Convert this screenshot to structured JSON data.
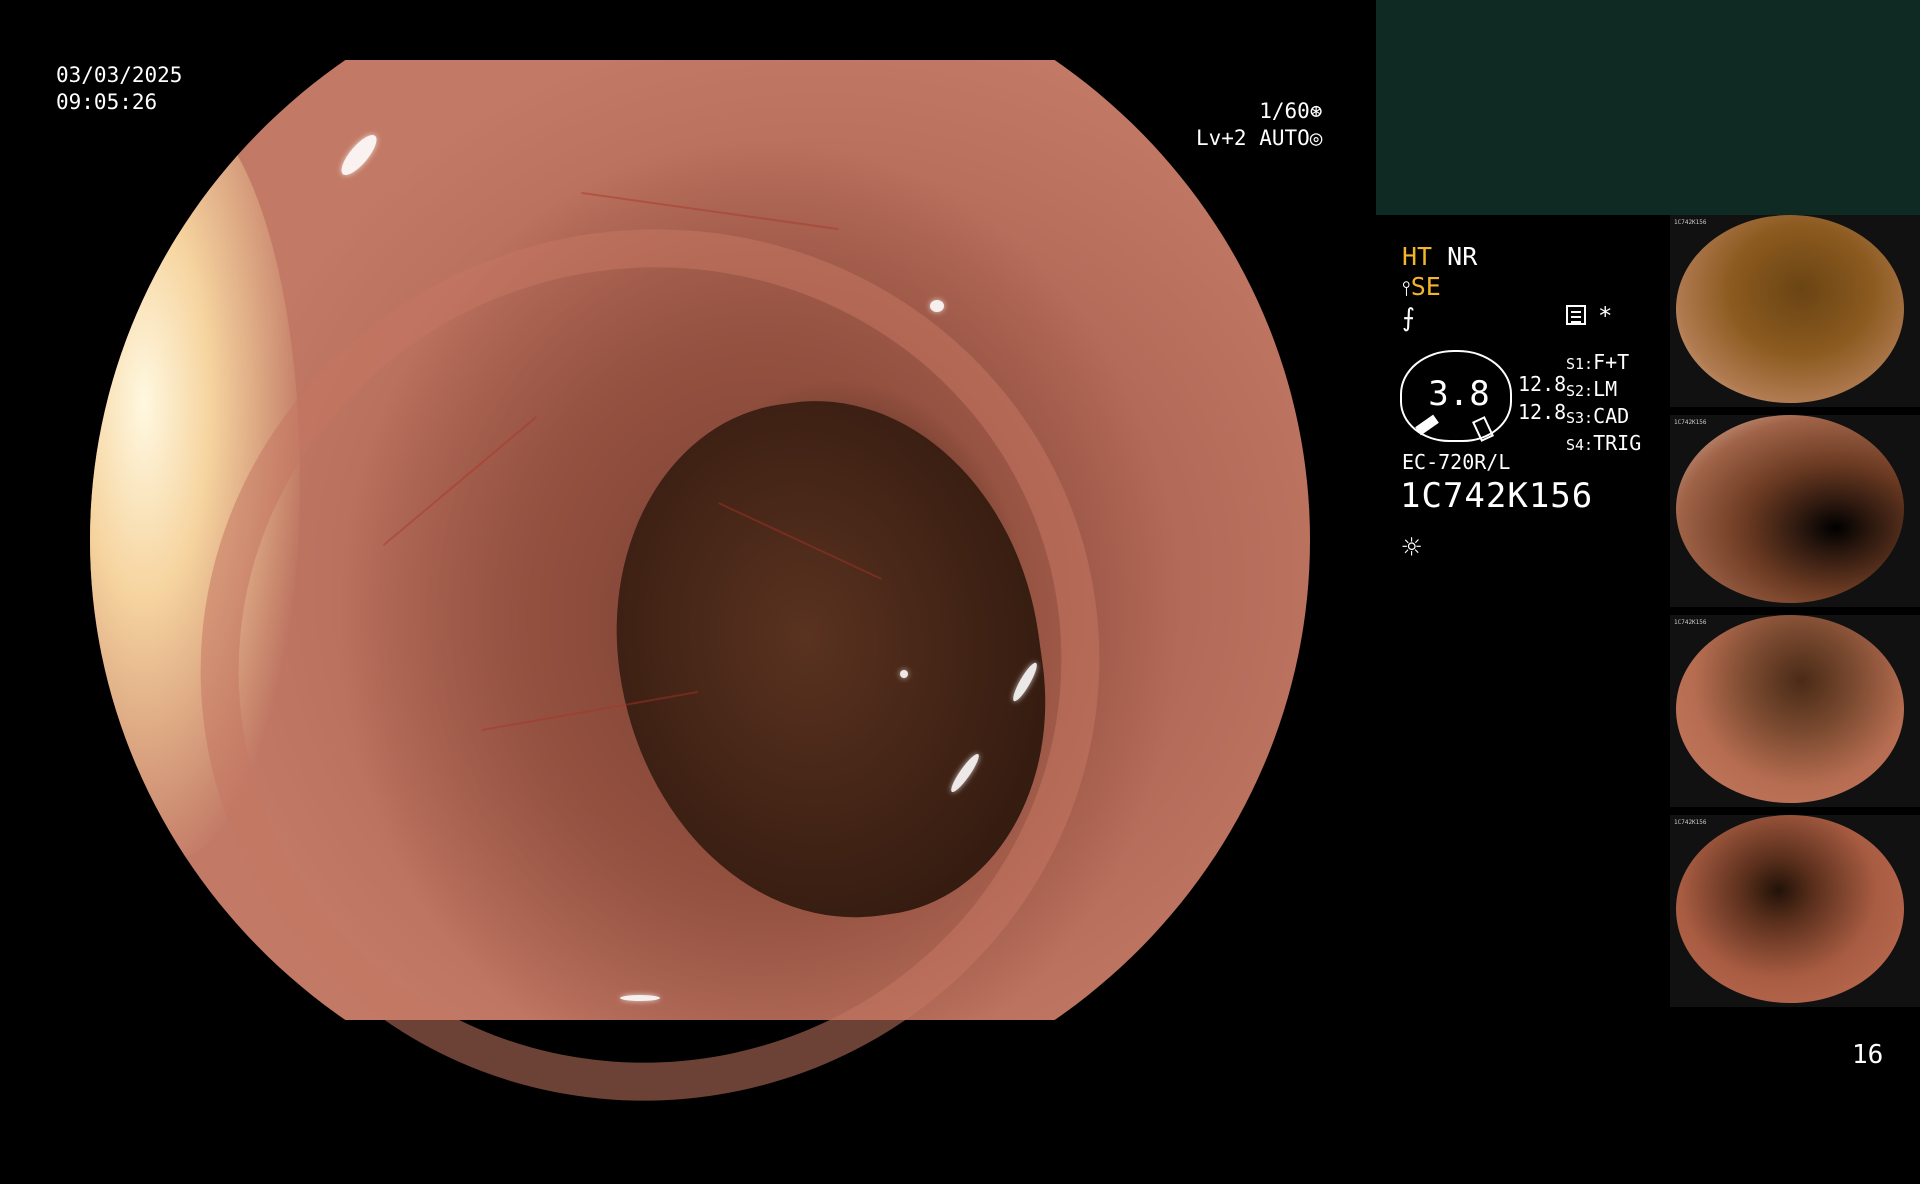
{
  "overlay": {
    "date": "03/03/2025",
    "time": "09:05:26",
    "shutter": "1/60",
    "shutter_icon": "aperture-icon",
    "level": "Lv+2 AUTO",
    "level_icon": "iris-icon"
  },
  "status": {
    "row1_a": "HT",
    "row1_b": "NR",
    "row2_icon": "enhance-icon",
    "row2": "SE",
    "row3_icon": "sharpness-icon",
    "colors": {
      "yellow": "#f3b52b",
      "white": "#ffffff",
      "teal_box": "#0f2a22"
    }
  },
  "gauge": {
    "value": "3.8",
    "num1": "12.8",
    "num2": "12.8"
  },
  "settings": [
    {
      "key": "S1:",
      "val": "F+T"
    },
    {
      "key": "S2:",
      "val": "LM"
    },
    {
      "key": "S3:",
      "val": "CAD"
    },
    {
      "key": "S4:",
      "val": "TRIG"
    }
  ],
  "icons": {
    "grid": "memory-icon",
    "asterisk": "asterisk-icon",
    "sun": "light-icon"
  },
  "scope": {
    "model": "EC-720R/L",
    "serial": "1C742K156"
  },
  "thumbnails": [
    {
      "caption": "1C742K156"
    },
    {
      "caption": "1C742K156"
    },
    {
      "caption": "1C742K156"
    },
    {
      "caption": "1C742K156"
    }
  ],
  "page_number": "16"
}
